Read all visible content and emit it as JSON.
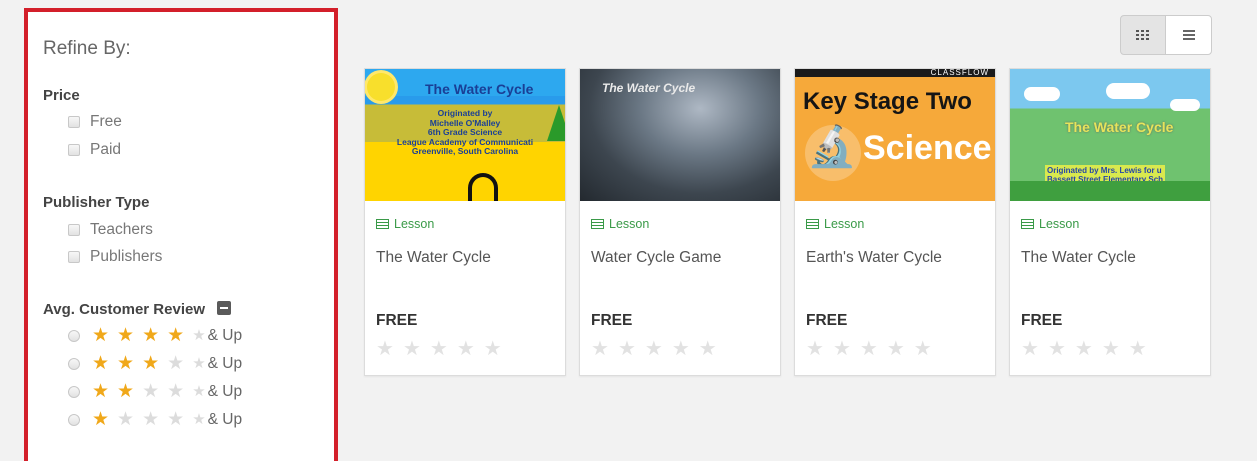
{
  "sidebar": {
    "title": "Refine By:",
    "price": {
      "heading": "Price",
      "options": [
        "Free",
        "Paid"
      ]
    },
    "publisher_type": {
      "heading": "Publisher Type",
      "options": [
        "Teachers",
        "Publishers"
      ]
    },
    "review": {
      "heading": "Avg. Customer Review",
      "suffix": "& Up",
      "min_ratings": [
        4,
        3,
        2,
        1
      ],
      "max_rating": 5
    }
  },
  "view_toggle": {
    "grid_icon": "grid-icon",
    "list_icon": "list-icon"
  },
  "cards": [
    {
      "type": "Lesson",
      "title": "The Water Cycle",
      "price": "FREE",
      "rating": 0,
      "thumb": {
        "title": "The Water Cycle",
        "lines": [
          "Originated by",
          "Michelle O'Malley",
          "6th Grade Science",
          "League Academy of Communicati",
          "Greenville, South Carolina"
        ]
      }
    },
    {
      "type": "Lesson",
      "title": "Water Cycle Game",
      "price": "FREE",
      "rating": 0,
      "thumb": {
        "title": "The Water Cycle"
      }
    },
    {
      "type": "Lesson",
      "title": "Earth's Water Cycle",
      "price": "FREE",
      "rating": 0,
      "thumb": {
        "brand": "CLASSFLOW",
        "title": "Key Stage Two",
        "subtitle": "Science"
      }
    },
    {
      "type": "Lesson",
      "title": "The Water Cycle",
      "price": "FREE",
      "rating": 0,
      "thumb": {
        "title": "The Water Cycle",
        "lines": [
          "Originated by Mrs. Lewis for u",
          "Bassett Street Elementary Sch"
        ]
      }
    }
  ],
  "colors": {
    "highlight_border": "#d31f2a",
    "star_on": "#f0a81a",
    "star_off": "#dcdcdc",
    "lesson_green": "#3a9a48"
  }
}
